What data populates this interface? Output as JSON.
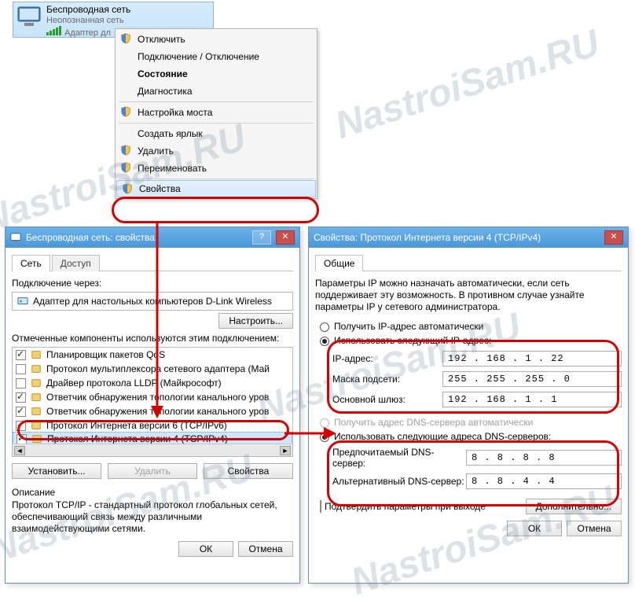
{
  "watermark": {
    "text": "NastroiSam.RU"
  },
  "network_header": {
    "title": "Беспроводная сеть",
    "subtitle": "Неопознанная сеть",
    "adapter_prefix": "Адаптер дл"
  },
  "context_menu": {
    "items": [
      {
        "label": "Отключить",
        "shield": true
      },
      {
        "label": "Подключение / Отключение",
        "shield": false
      },
      {
        "label": "Состояние",
        "shield": false,
        "bold": true
      },
      {
        "label": "Диагностика",
        "shield": false
      },
      {
        "sep": true
      },
      {
        "label": "Настройка моста",
        "shield": true
      },
      {
        "sep": true
      },
      {
        "label": "Создать ярлык",
        "shield": false
      },
      {
        "label": "Удалить",
        "shield": true
      },
      {
        "label": "Переименовать",
        "shield": true
      },
      {
        "sep": true
      },
      {
        "label": "Свойства",
        "shield": true,
        "highlight": true
      }
    ]
  },
  "props_dialog": {
    "title": "Беспроводная сеть: свойства",
    "tabs": {
      "network": "Сеть",
      "access": "Доступ"
    },
    "connect_via_label": "Подключение через:",
    "adapter_name": "Адаптер для настольных компьютеров D-Link Wireless",
    "configure_btn": "Настроить...",
    "components_label": "Отмеченные компоненты используются этим подключением:",
    "components": [
      {
        "checked": true,
        "label": "Планировщик пакетов QoS"
      },
      {
        "checked": false,
        "label": "Протокол мультиплексора сетевого адаптера (Май"
      },
      {
        "checked": false,
        "label": "Драйвер протокола LLDP (Майкрософт)"
      },
      {
        "checked": true,
        "label": "Ответчик обнаружения топологии канального уров"
      },
      {
        "checked": true,
        "label": "Ответчик обнаружения топологии канального уров"
      },
      {
        "checked": true,
        "label": "Протокол Интернета версии 6 (TCP/IPv6)"
      },
      {
        "checked": true,
        "label": "Протокол Интернета версии 4 (TCP/IPv4)",
        "selected": true
      }
    ],
    "install_btn": "Установить...",
    "remove_btn": "Удалить",
    "properties_btn": "Свойства",
    "description_title": "Описание",
    "description_text": "Протокол TCP/IP - стандартный протокол глобальных сетей, обеспечивающий связь между различными взаимодействующими сетями.",
    "ok_btn": "ОК",
    "cancel_btn": "Отмена"
  },
  "ip_dialog": {
    "title": "Свойства: Протокол Интернета версии 4 (TCP/IPv4)",
    "tab_general": "Общие",
    "intro": "Параметры IP можно назначать автоматически, если сеть поддерживает эту возможность. В противном случае узнайте параметры IP у сетевого администратора.",
    "radio_auto_ip": "Получить IP-адрес автоматически",
    "radio_manual_ip": "Использовать следующий IP-адрес:",
    "ip_label": "IP-адрес:",
    "ip_value": "192 . 168 .   1 .  22",
    "mask_label": "Маска подсети:",
    "mask_value": "255 . 255 . 255 .   0",
    "gw_label": "Основной шлюз:",
    "gw_value": "192 . 168 .   1 .   1",
    "radio_auto_dns": "Получить адрес DNS-сервера автоматически",
    "radio_manual_dns": "Использовать следующие адреса DNS-серверов:",
    "dns1_label": "Предпочитаемый DNS-сервер:",
    "dns1_value": "  8 .   8 .   8 .   8",
    "dns2_label": "Альтернативный DNS-сервер:",
    "dns2_value": "  8 .   8 .   4 .   4",
    "confirm_label": "Подтвердить параметры при выходе",
    "advanced_btn": "Дополнительно...",
    "ok_btn": "ОК",
    "cancel_btn": "Отмена"
  }
}
